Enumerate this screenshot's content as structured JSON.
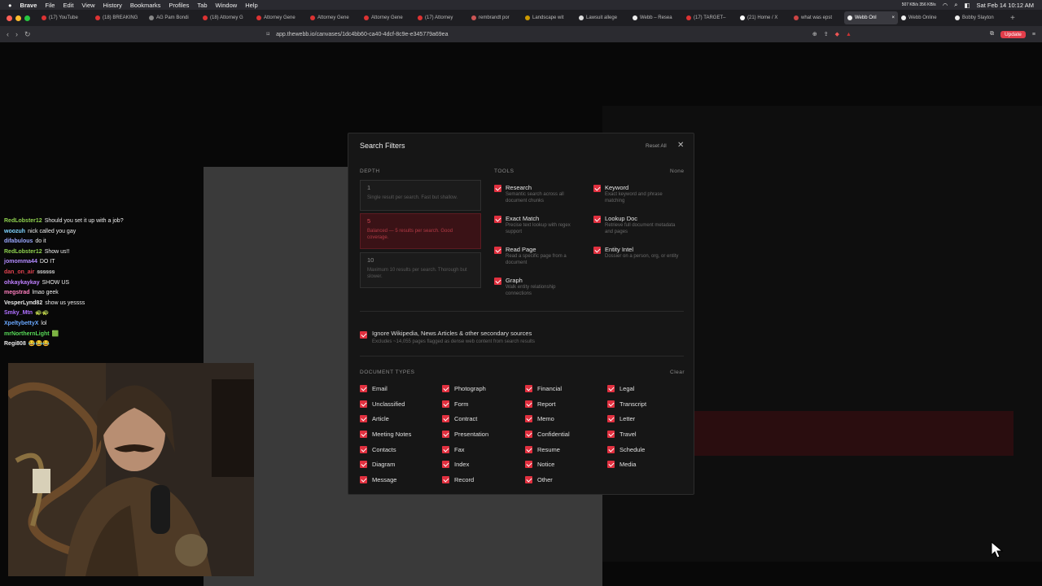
{
  "menubar": {
    "apple": "",
    "app": "Brave",
    "items": [
      "File",
      "Edit",
      "View",
      "History",
      "Bookmarks",
      "Profiles",
      "Tab",
      "Window",
      "Help"
    ],
    "clock": "Sat Feb 14  10:12 AM",
    "net": "507 KB/s 356 KB/s"
  },
  "tabs": [
    "(17) YouTube",
    "(18) BREAKING",
    "AG Pam Bondi",
    "(18) Attorney G",
    "Attorney Gene",
    "Attorney Gene",
    "Attorney Gene",
    "(17) Attorney",
    "rembrandt por",
    "Landscape wit",
    "Lawsuit allege",
    "Webb – Resea",
    "(17) TARGET–",
    "(21) Home / X",
    "what was epst",
    "Webb Onl",
    "Webb Online",
    "Bobby Slayton"
  ],
  "url": "app.thewebb.io/canvases/1dc4bb60-ca40-4dcf-8c9e-e345779a69ea",
  "update": "Update",
  "chat": [
    {
      "user": "RedLobster12",
      "color": "#8fd14f",
      "msg": "Should you set it up with a job?"
    },
    {
      "user": "woozuh",
      "color": "#7fd4ff",
      "msg": "nick called you gay"
    },
    {
      "user": "difabulous",
      "color": "#9aa8ff",
      "msg": "do it"
    },
    {
      "user": "RedLobster12",
      "color": "#8fd14f",
      "msg": "Show us!!"
    },
    {
      "user": "jomomma44",
      "color": "#b38cff",
      "msg": "DO IT"
    },
    {
      "user": "dan_on_air",
      "color": "#e0424f",
      "msg": "ꞩꞩꞩꞩꞩꞩ"
    },
    {
      "user": "ohkaykaykay",
      "color": "#c080ff",
      "msg": "SHOW US"
    },
    {
      "user": "megstrad",
      "color": "#ff7fbf",
      "msg": "lmao geek"
    },
    {
      "user": "VesperLynd82",
      "color": "#e8e8e8",
      "msg": "show us yessss"
    },
    {
      "user": "Smky_Mtn",
      "color": "#b070ff",
      "msg": "🐢🐢"
    },
    {
      "user": "XpeltybettyX",
      "color": "#6aa8ff",
      "msg": "lol"
    },
    {
      "user": "mrNorthernLight",
      "color": "#57d957",
      "msg": "🟩"
    },
    {
      "user": "Regi808",
      "color": "#e8e8e8",
      "msg": "😂😂😂"
    }
  ],
  "modal": {
    "title": "Search Filters",
    "reset": "Reset All",
    "close": "✕",
    "depth_label": "DEPTH",
    "depth": [
      {
        "n": "1",
        "d": "Single result per search. Fast but shallow."
      },
      {
        "n": "5",
        "d": "Balanced — 5 results per search. Good coverage."
      },
      {
        "n": "10",
        "d": "Maximum 10 results per search. Thorough but slower."
      }
    ],
    "tools_label": "TOOLS",
    "none": "None",
    "tools": [
      {
        "t": "Research",
        "s": "Semantic search across all document chunks"
      },
      {
        "t": "Keyword",
        "s": "Exact keyword and phrase matching"
      },
      {
        "t": "Exact Match",
        "s": "Precise text lookup with regex support"
      },
      {
        "t": "Lookup Doc",
        "s": "Retrieve full document metadata and pages"
      },
      {
        "t": "Read Page",
        "s": "Read a specific page from a document"
      },
      {
        "t": "Entity Intel",
        "s": "Dossier on a person, org, or entity"
      },
      {
        "t": "Graph",
        "s": "Walk entity relationship connections"
      }
    ],
    "ignore": {
      "t": "Ignore Wikipedia, News Articles & other secondary sources",
      "s": "Excludes ~14,055 pages flagged as dense web content from search results"
    },
    "doctypes_label": "DOCUMENT TYPES",
    "clear": "Clear",
    "doctypes": [
      "Email",
      "Photograph",
      "Financial",
      "Legal",
      "Unclassified",
      "Form",
      "Report",
      "Transcript",
      "Article",
      "Contract",
      "Memo",
      "Letter",
      "Meeting Notes",
      "Presentation",
      "Confidential",
      "Travel",
      "Contacts",
      "Fax",
      "Resume",
      "Schedule",
      "Diagram",
      "Index",
      "Notice",
      "Media",
      "Message",
      "Record",
      "Other"
    ]
  }
}
